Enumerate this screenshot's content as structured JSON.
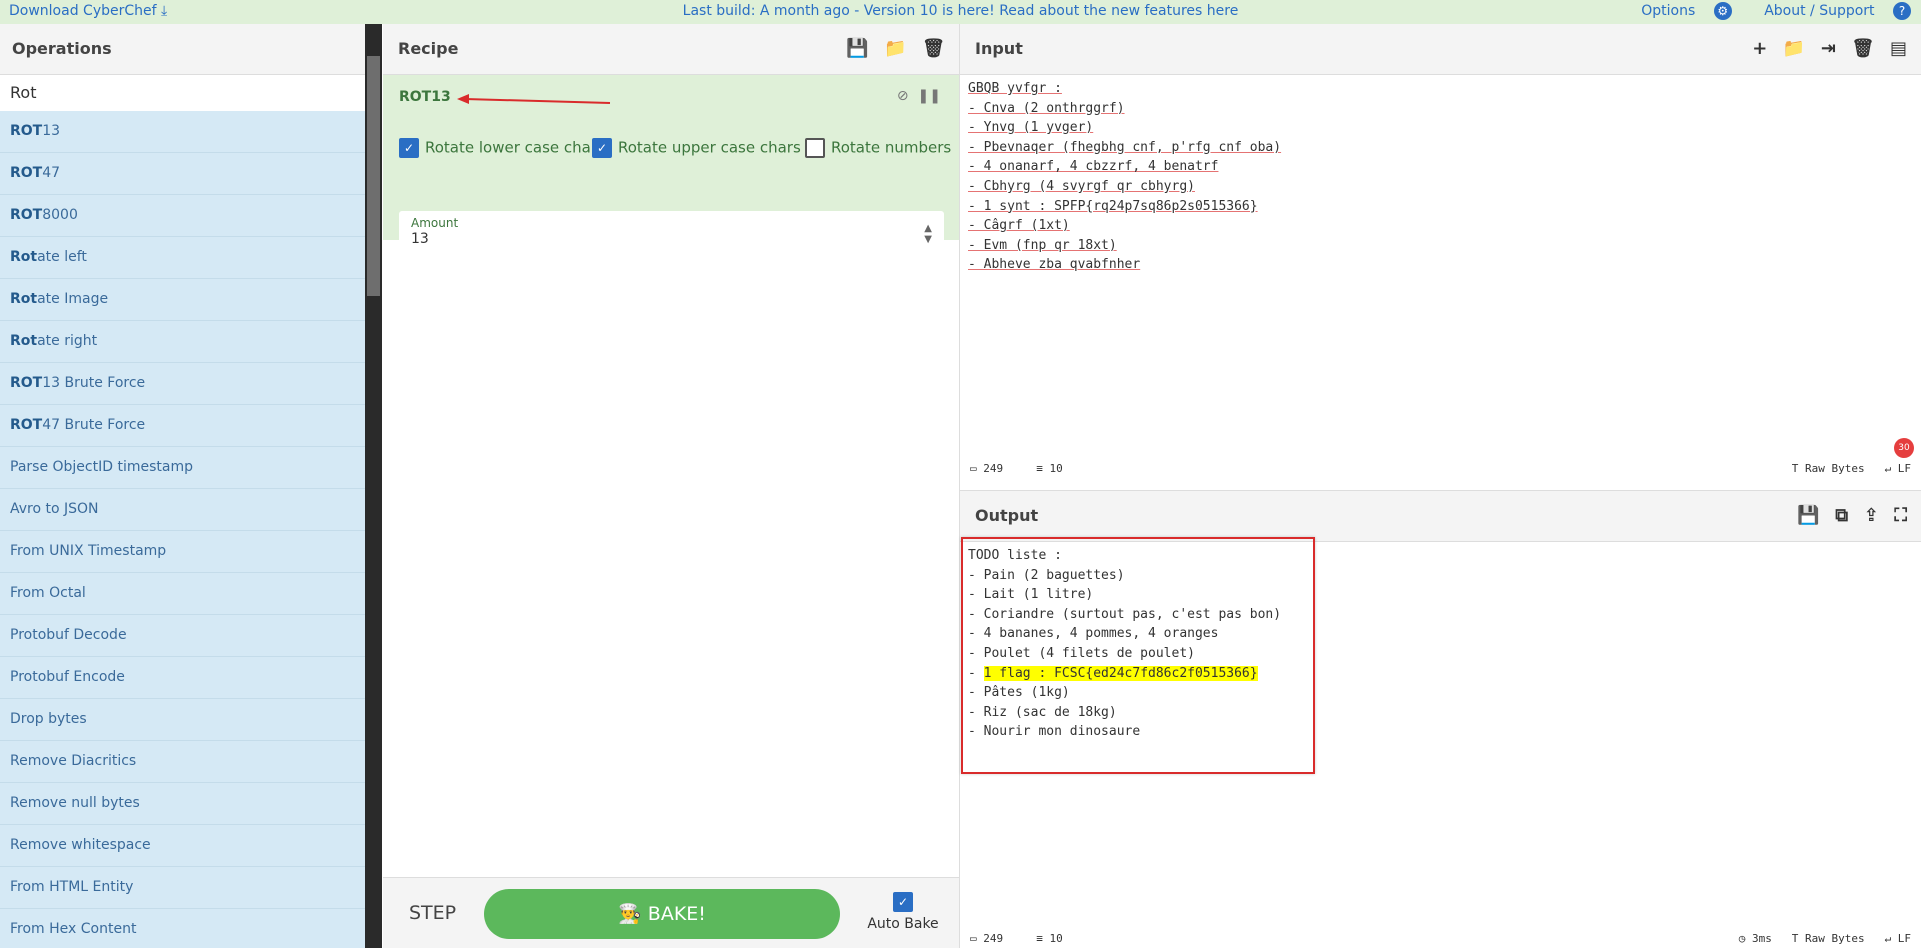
{
  "topbar": {
    "download": "Download CyberChef",
    "build": "Last build: A month ago - Version 10 is here! Read about the new features here",
    "options": "Options",
    "about": "About / Support"
  },
  "operations": {
    "title": "Operations",
    "search": "Rot",
    "items": [
      {
        "bold": "ROT",
        "rest": "13"
      },
      {
        "bold": "ROT",
        "rest": "47"
      },
      {
        "bold": "ROT",
        "rest": "8000"
      },
      {
        "bold": "Rot",
        "rest": "ate left"
      },
      {
        "bold": "Rot",
        "rest": "ate Image"
      },
      {
        "bold": "Rot",
        "rest": "ate right"
      },
      {
        "bold": "ROT",
        "rest": "13 Brute Force"
      },
      {
        "bold": "ROT",
        "rest": "47 Brute Force"
      },
      {
        "bold": "",
        "rest": "Parse ObjectID timestamp"
      },
      {
        "bold": "",
        "rest": "Avro to JSON"
      },
      {
        "bold": "",
        "rest": "From UNIX Timestamp"
      },
      {
        "bold": "",
        "rest": "From Octal"
      },
      {
        "bold": "",
        "rest": "Protobuf Decode"
      },
      {
        "bold": "",
        "rest": "Protobuf Encode"
      },
      {
        "bold": "",
        "rest": "Drop bytes"
      },
      {
        "bold": "",
        "rest": "Remove Diacritics"
      },
      {
        "bold": "",
        "rest": "Remove null bytes"
      },
      {
        "bold": "",
        "rest": "Remove whitespace"
      },
      {
        "bold": "",
        "rest": "From HTML Entity"
      },
      {
        "bold": "",
        "rest": "From Hex Content"
      }
    ]
  },
  "recipe": {
    "title": "Recipe",
    "op_name": "ROT13",
    "chk_lower": "Rotate lower case chars",
    "chk_upper": "Rotate upper case chars",
    "chk_numbers": "Rotate numbers",
    "amount_label": "Amount",
    "amount_value": "13",
    "step": "STEP",
    "bake": "BAKE!",
    "autobake": "Auto Bake"
  },
  "input": {
    "title": "Input",
    "lines": [
      "GBQB yvfgr :",
      "- Cnva (2 onthrggrf)",
      "- Ynvg (1 yvger)",
      "- Pbevnaqer (fhegbhg cnf, p'rfg cnf oba)",
      "- 4 onanarf, 4 cbzzrf, 4 benatrf",
      "- Cbhyrg (4 svyrgf qr cbhyrg)",
      "- 1 synt : SPFP{rq24p7sq86p2s0515366}",
      "- Câgrf (1xt)",
      "- Evm (fnp qr 18xt)",
      "- Abhevе zba qvabfnher"
    ],
    "status_chars": "249",
    "status_lines": "10",
    "badge": "30",
    "raw": "Raw Bytes",
    "lf": "LF"
  },
  "output": {
    "title": "Output",
    "lines": [
      "TODO liste :",
      "- Pain (2 baguettes)",
      "- Lait (1 litre)",
      "- Coriandre (surtout pas, c'est pas bon)",
      "- 4 bananes, 4 pommes, 4 oranges",
      "- Poulet (4 filets de poulet)",
      "- 1 flag : FCSC{ed24c7fd86c2f0515366}",
      "- Pâtes (1kg)",
      "- Riz (sac de 18kg)",
      "- Nourir mon dinosaure"
    ],
    "status_chars": "249",
    "status_lines": "10",
    "time": "3ms",
    "raw": "Raw Bytes",
    "lf": "LF"
  }
}
